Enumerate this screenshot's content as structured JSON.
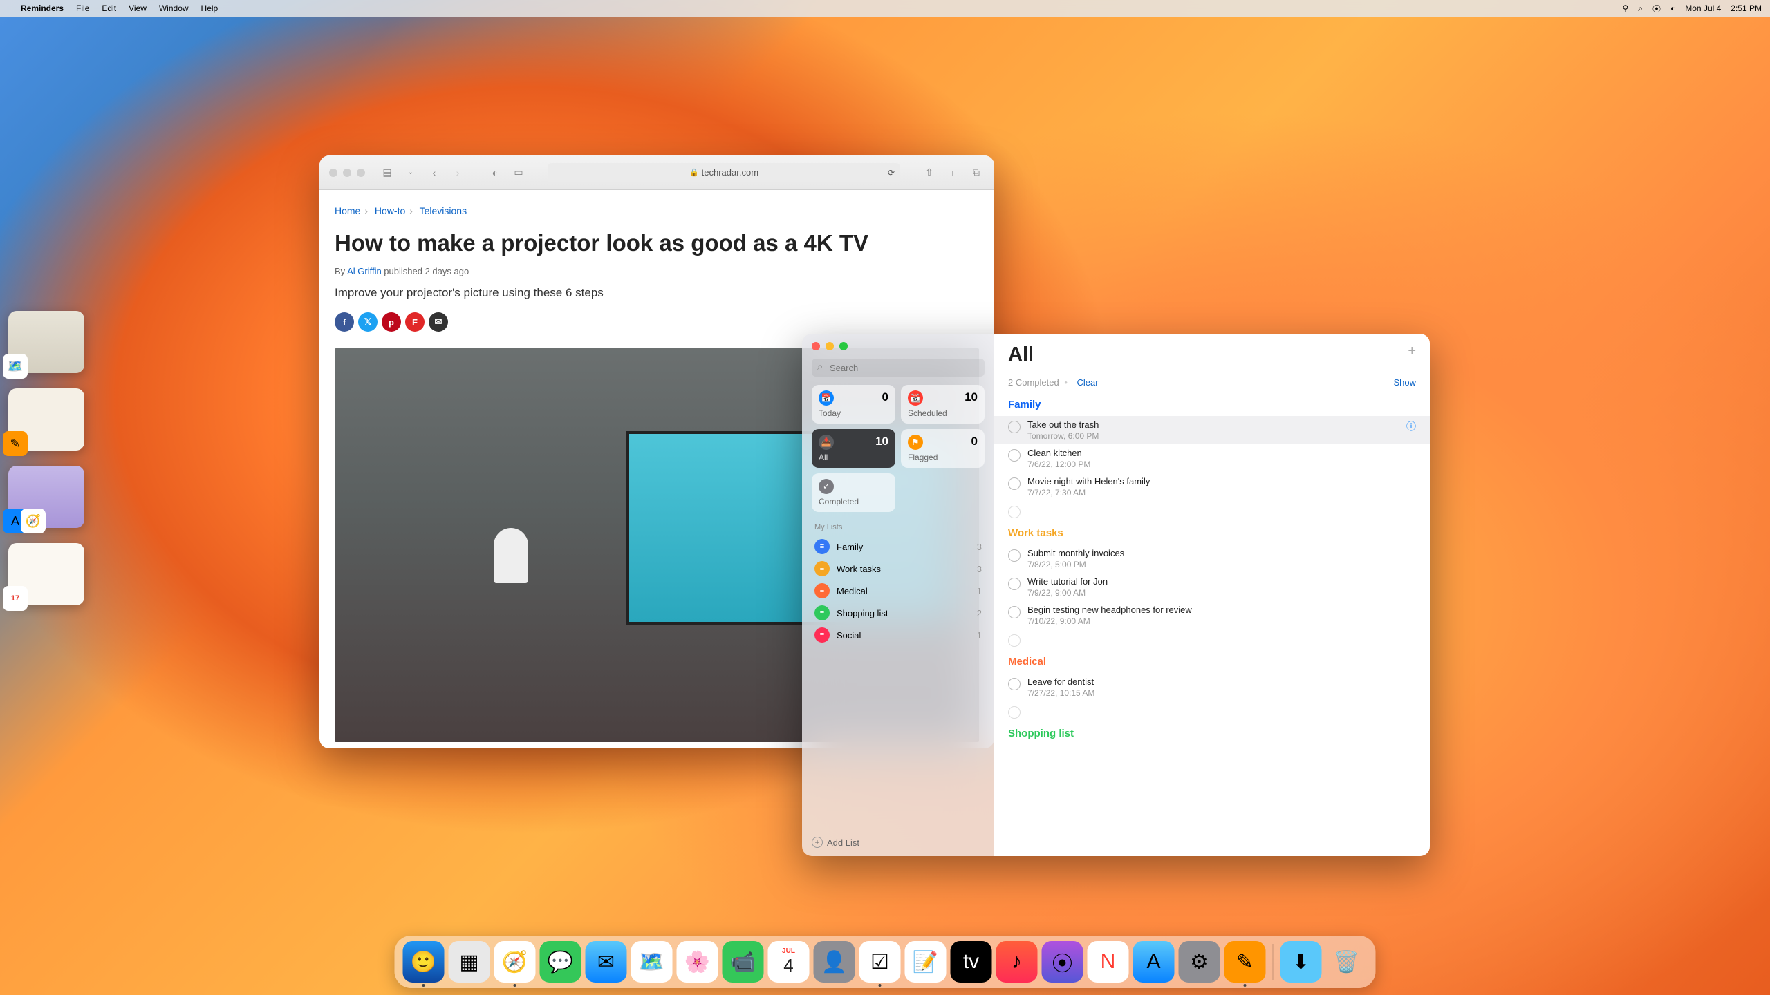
{
  "menubar": {
    "app": "Reminders",
    "items": [
      "File",
      "Edit",
      "View",
      "Window",
      "Help"
    ],
    "status": {
      "date": "Mon Jul 4",
      "time": "2:51 PM"
    }
  },
  "safari": {
    "domain": "techradar.com",
    "breadcrumbs": [
      "Home",
      "How-to",
      "Televisions"
    ],
    "title": "How to make a projector look as good as a 4K TV",
    "by": "By ",
    "author": "Al Griffin",
    "published": " published 2 days ago",
    "subtitle": "Improve your projector's picture using these 6 steps"
  },
  "reminders": {
    "search_placeholder": "Search",
    "smart": {
      "today": {
        "label": "Today",
        "count": "0"
      },
      "scheduled": {
        "label": "Scheduled",
        "count": "10"
      },
      "all": {
        "label": "All",
        "count": "10"
      },
      "flagged": {
        "label": "Flagged",
        "count": "0"
      },
      "completed": {
        "label": "Completed"
      }
    },
    "mylists_label": "My Lists",
    "lists": [
      {
        "name": "Family",
        "count": "3",
        "color": "#3478f6"
      },
      {
        "name": "Work tasks",
        "count": "3",
        "color": "#f5a623"
      },
      {
        "name": "Medical",
        "count": "1",
        "color": "#ff6b35"
      },
      {
        "name": "Shopping list",
        "count": "2",
        "color": "#2ec95c"
      },
      {
        "name": "Social",
        "count": "1",
        "color": "#ff2d55"
      }
    ],
    "add_list": "Add List",
    "main": {
      "title": "All",
      "completed_text": "2 Completed",
      "dot": "•",
      "clear": "Clear",
      "show": "Show",
      "sections": [
        {
          "name": "Family",
          "color": "#0b63f5",
          "tasks": [
            {
              "title": "Take out the trash",
              "meta": "Tomorrow, 6:00 PM",
              "hl": true,
              "info": true
            },
            {
              "title": "Clean kitchen",
              "meta": "7/6/22, 12:00 PM"
            },
            {
              "title": "Movie night with Helen's family",
              "meta": "7/7/22, 7:30 AM"
            },
            {
              "title": "",
              "meta": "",
              "empty": true
            }
          ]
        },
        {
          "name": "Work tasks",
          "color": "#f5a623",
          "tasks": [
            {
              "title": "Submit monthly invoices",
              "meta": "7/8/22, 5:00 PM"
            },
            {
              "title": "Write tutorial for Jon",
              "meta": "7/9/22, 9:00 AM"
            },
            {
              "title": "Begin testing new headphones for review",
              "meta": "7/10/22, 9:00 AM"
            },
            {
              "title": "",
              "meta": "",
              "empty": true
            }
          ]
        },
        {
          "name": "Medical",
          "color": "#ff6b35",
          "tasks": [
            {
              "title": "Leave for dentist",
              "meta": "7/27/22, 10:15 AM"
            },
            {
              "title": "",
              "meta": "",
              "empty": true
            }
          ]
        },
        {
          "name": "Shopping list",
          "color": "#2ec95c",
          "tasks": []
        }
      ]
    }
  },
  "dock": {
    "apps": [
      "Finder",
      "Launchpad",
      "Safari",
      "Messages",
      "Mail",
      "Maps",
      "Photos",
      "FaceTime",
      "Calendar",
      "Contacts",
      "Reminders",
      "Notes",
      "TV",
      "Music",
      "Podcasts",
      "News",
      "AppStore",
      "Settings",
      "Pages"
    ],
    "right": [
      "Downloads",
      "Trash"
    ],
    "calendar_badge": "4",
    "calendar_month": "JUL"
  },
  "colors": {
    "fb": "#3b5998",
    "tw": "#1da1f2",
    "pin": "#bd081c",
    "fl": "#e12828",
    "mail": "#333"
  }
}
